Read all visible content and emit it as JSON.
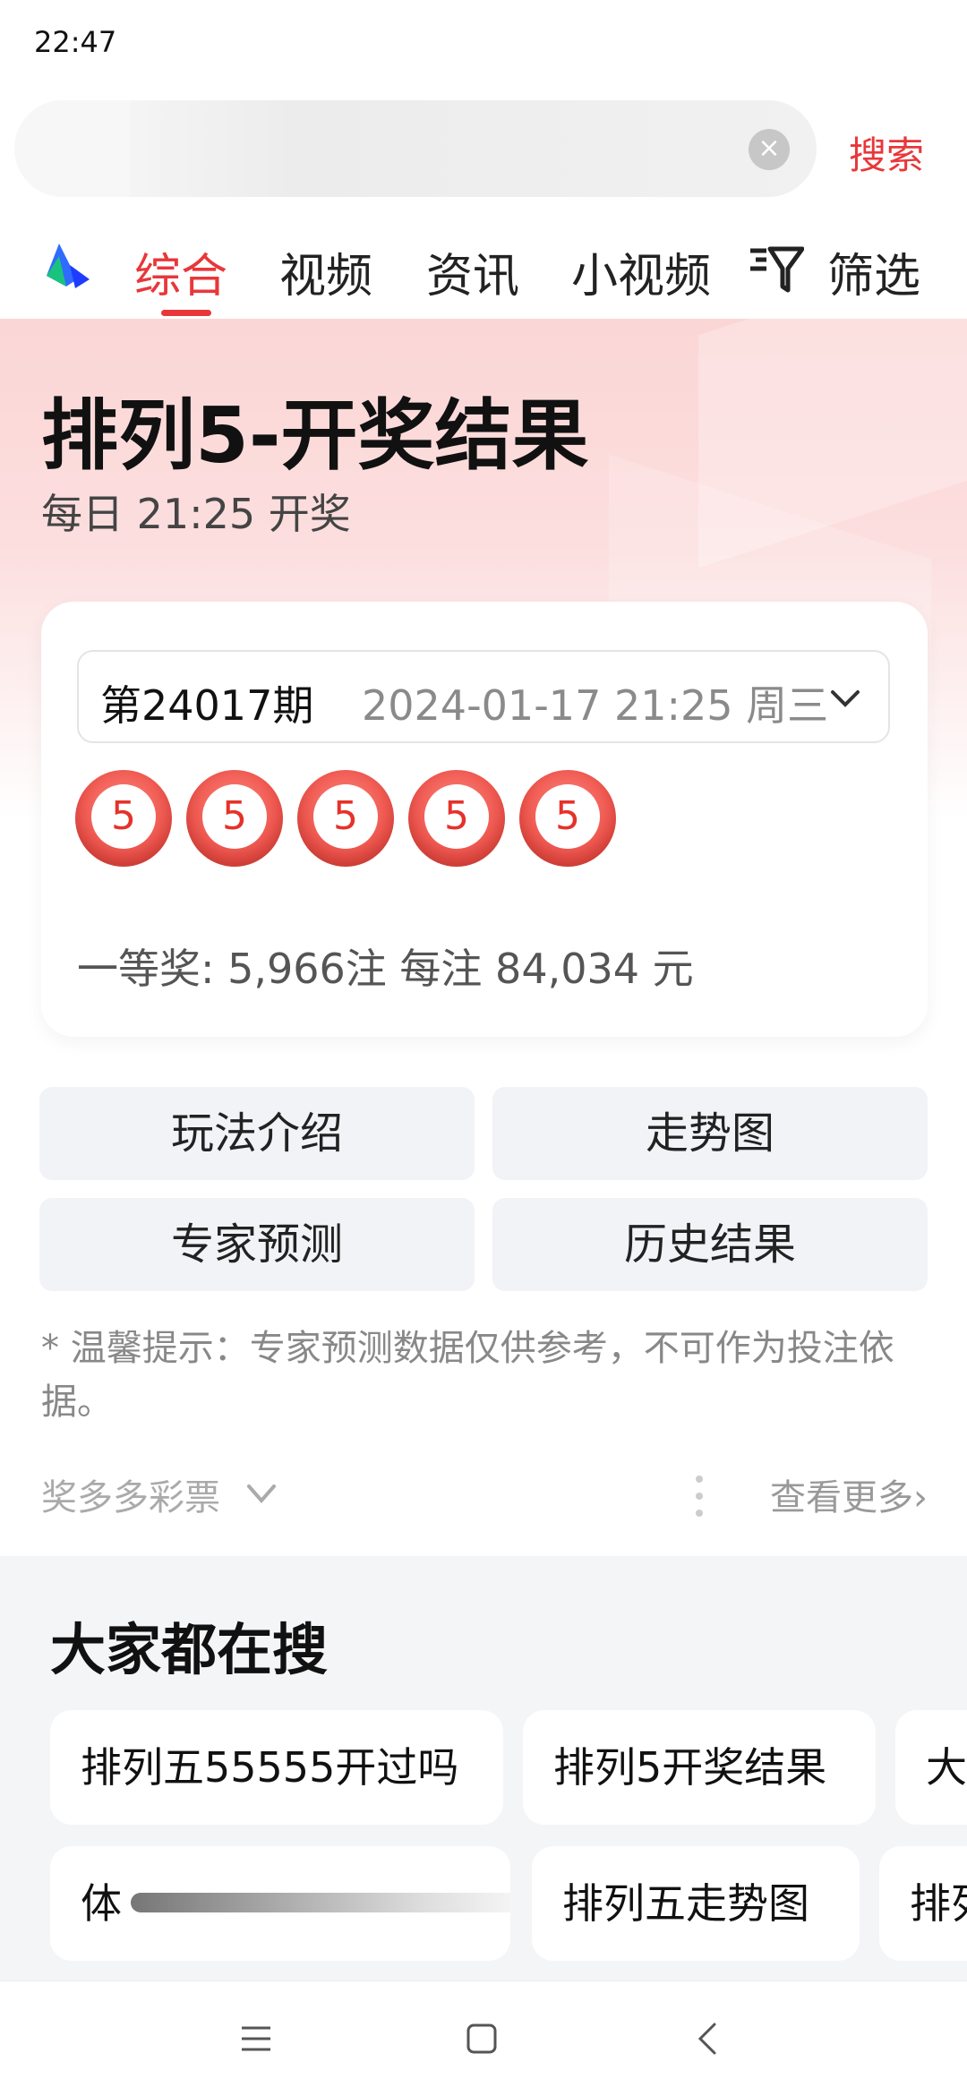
{
  "status_bar": {
    "time": "22:47"
  },
  "search": {
    "query": "",
    "button_label": "搜索",
    "clear_icon": "close-circle-icon"
  },
  "tabs": [
    {
      "label": "综合",
      "active": true
    },
    {
      "label": "视频",
      "active": false
    },
    {
      "label": "资讯",
      "active": false
    },
    {
      "label": "小视频",
      "active": false
    }
  ],
  "filter": {
    "label": "筛选",
    "icon": "filter-icon"
  },
  "hero": {
    "title": "排列5-开奖结果",
    "subtitle": "每日 21:25 开奖"
  },
  "result_card": {
    "issue": "第24017期",
    "date": "2024-01-17 21:25 周三",
    "balls": [
      "5",
      "5",
      "5",
      "5",
      "5"
    ],
    "prize_line": "一等奖: 5,966注 每注 84,034 元"
  },
  "actions": [
    {
      "label": "玩法介绍"
    },
    {
      "label": "走势图"
    },
    {
      "label": "专家预测"
    },
    {
      "label": "历史结果"
    }
  ],
  "tip": "* 温馨提示：专家预测数据仅供参考，不可作为投注依据。",
  "source": {
    "name": "奖多多彩票",
    "more": "查看更多›"
  },
  "everyone_search": {
    "title": "大家都在搜",
    "row1": [
      "排列五55555开过吗",
      "排列5开奖结果",
      "大"
    ],
    "row2": [
      "体",
      "排列五走势图",
      "排列"
    ]
  },
  "colors": {
    "accent": "#e8373a",
    "ball": "#ea4a42",
    "button_bg": "#f1f3f6",
    "section_bg": "#f4f5f7"
  }
}
